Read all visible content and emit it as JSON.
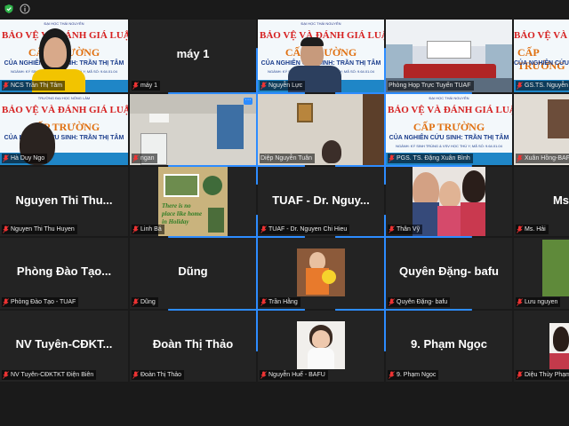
{
  "banner": {
    "university": "ĐẠI HỌC THÁI NGUYÊN",
    "school": "TRƯỜNG ĐẠI HỌC NÔNG LÂM",
    "heading": "BẢO VỆ VÀ ĐÁNH GIÁ LUẬN ÁN TIẾN SĨ",
    "level": "CẤP TRƯỜNG",
    "candidate": "CỦA NGHIÊN CỨU SINH: TRẦN THỊ TÂM",
    "major": "NGÀNH: KÝ SINH TRÙNG & VSV HỌC THÚ Y; MÃ SỐ: 9.64.01.04"
  },
  "center_names": {
    "may1": "máy 1",
    "nguyen_thi_thu": "Nguyen Thi Thu...",
    "tuaf": "TUAF - Dr. Nguy...",
    "ms_partial": "Ms",
    "phong_dao_tao": "Phòng Đào Tạo...",
    "dung": "Dũng",
    "quyen_dang": "Quyên Đặng- bafu",
    "nv_tuyen": "NV Tuyên-CĐKT...",
    "doan_thi_thao": "Đoàn Thị Thảo",
    "pham_ngoc": "9. Phạm Ngọc"
  },
  "photo_text": {
    "holiday": "There is no place like home in Holiday"
  },
  "labels": {
    "r1c1": "NCS Trần Thị Tâm",
    "r1c2": "máy 1",
    "r1c3": "Nguyễn Lực",
    "r1c4": "Phòng Họp Trực Tuyến TUAF",
    "r1c5": "GS.TS. Nguyễn T",
    "r2c1": "Hà Duy Ngo",
    "r2c2": "ngan",
    "r2c3": "Diệp Nguyễn Tuân",
    "r2c4": "PGS. TS. Đặng Xuân Bình",
    "r2c5": "Xuân Hồng-BAFU",
    "r3c1": "Nguyen Thi Thu Huyen",
    "r3c2": "Linh Bá",
    "r3c3": "TUAF - Dr. Nguyen Chi Hieu",
    "r3c4": "Thân Vỹ",
    "r3c5": "Ms. Hải",
    "r4c1": "Phòng Đào Tạo - TUAF",
    "r4c2": "Dũng",
    "r4c3": "Trần Hằng",
    "r4c4": "Quyên Đặng- bafu",
    "r4c5": "Lưu nguyen",
    "r5c1": "NV Tuyên-CĐKTKT Điện Biên",
    "r5c2": "Đoàn Thị Thảo",
    "r5c3": "Nguyễn Huế - BAFU",
    "r5c4": "9. Phạm Ngọc",
    "r5c5": "Diệu Thùy Phạm"
  },
  "icons": [
    "shield-icon",
    "info-icon",
    "gallery-grid-icon",
    "mic-muted-icon",
    "more-options-icon"
  ],
  "colors": {
    "background": "#1a1a1a",
    "tile": "#232323",
    "active_speaker": "#4fd15a",
    "banner_red": "#d62020",
    "banner_orange": "#e07010",
    "banner_blue": "#1b3d8c",
    "zoom_blue": "#2d8cff"
  }
}
